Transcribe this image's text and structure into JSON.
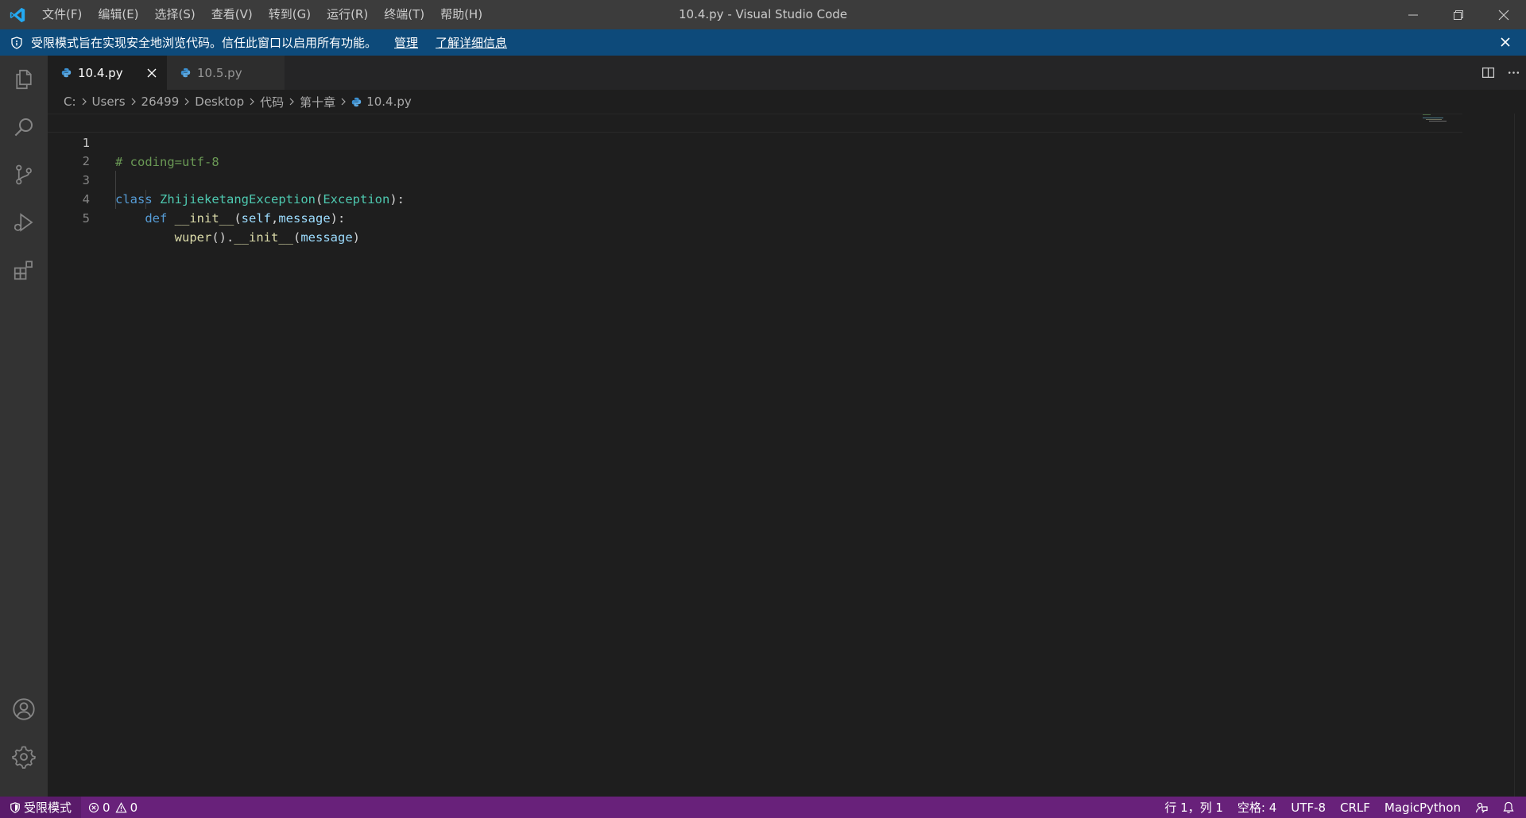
{
  "window": {
    "title": "10.4.py - Visual Studio Code"
  },
  "menu": {
    "items": [
      "文件(F)",
      "编辑(E)",
      "选择(S)",
      "查看(V)",
      "转到(G)",
      "运行(R)",
      "终端(T)",
      "帮助(H)"
    ]
  },
  "banner": {
    "message": "受限模式旨在实现安全地浏览代码。信任此窗口以启用所有功能。",
    "manage_link": "管理",
    "learn_more_link": "了解详细信息"
  },
  "activitybar": {
    "icons": [
      "explorer-icon",
      "search-icon",
      "source-control-icon",
      "run-debug-icon",
      "extensions-icon",
      "account-icon",
      "gear-icon"
    ]
  },
  "tabs": [
    {
      "label": "10.4.py",
      "active": true
    },
    {
      "label": "10.5.py",
      "active": false
    }
  ],
  "breadcrumb": {
    "parts": [
      "C:",
      "Users",
      "26499",
      "Desktop",
      "代码",
      "第十章"
    ],
    "file": "10.4.py"
  },
  "editor": {
    "lines": [
      {
        "num": "1",
        "text": "# coding=utf-8"
      },
      {
        "num": "2",
        "text": ""
      },
      {
        "num": "3",
        "text": "class ZhijieketangException(Exception):"
      },
      {
        "num": "4",
        "text": "    def __init__(self,message):"
      },
      {
        "num": "5",
        "text": "        wuper().__init__(message)"
      }
    ],
    "tokens": {
      "l1_comment": "# coding=utf-8",
      "l3_kw": "class",
      "l3_name": "ZhijieketangException",
      "l3_paren_open": "(",
      "l3_base": "Exception",
      "l3_paren_close": "):",
      "l4_kw": "def",
      "l4_fn": "__init__",
      "l4_open": "(",
      "l4_p1": "self",
      "l4_comma": ",",
      "l4_p2": "message",
      "l4_close": "):",
      "l5_fn1": "wuper",
      "l5_mid": "().",
      "l5_fn2": "__init__",
      "l5_open": "(",
      "l5_arg": "message",
      "l5_close": ")"
    }
  },
  "statusbar": {
    "restricted_mode": "受限模式",
    "errors": "0",
    "warnings": "0",
    "position": "行 1，列 1",
    "spaces": "空格: 4",
    "encoding": "UTF-8",
    "eol": "CRLF",
    "language": "MagicPython"
  },
  "colors": {
    "statusbar_bg": "#68217a",
    "banner_bg": "#0d4a7a",
    "accent": "#007acc"
  }
}
